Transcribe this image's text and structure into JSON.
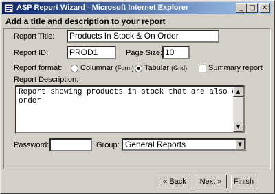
{
  "window": {
    "title": "ASP Report Wizard - Microsoft Internet Explorer",
    "min_glyph": "_",
    "max_glyph": "□",
    "close_glyph": "✕"
  },
  "header": {
    "title": "Add a title and description to your report"
  },
  "form": {
    "report_title_label": "Report Title:",
    "report_title_value": "Products In Stock & On Order",
    "report_id_label": "Report ID:",
    "report_id_value": "PROD1",
    "page_size_label": "Page Size:",
    "page_size_value": "10",
    "report_format_label": "Report format:",
    "format_options": [
      {
        "label": "Columnar",
        "note": "(Form)",
        "selected": false
      },
      {
        "label": "Tabular",
        "note": "(Grid)",
        "selected": true
      }
    ],
    "summary_label": "Summary report",
    "summary_checked": false,
    "description_label": "Report Description:",
    "description_value": "Report showing products in stock that are also on order",
    "password_label": "Password:",
    "password_value": "",
    "group_label": "Group:",
    "group_value": "General Reports"
  },
  "buttons": {
    "back": "« Back",
    "next": "Next »",
    "finish": "Finish"
  }
}
